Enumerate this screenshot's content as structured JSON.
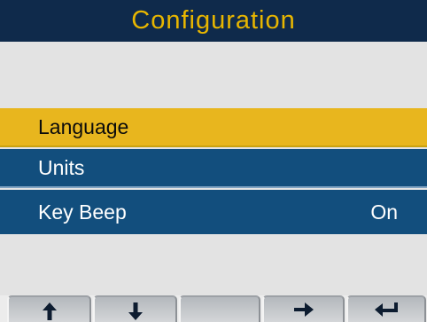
{
  "header": {
    "title": "Configuration"
  },
  "menu": {
    "items": [
      {
        "label": "Language",
        "value": ""
      },
      {
        "label": "Units",
        "value": ""
      },
      {
        "label": "Key Beep",
        "value": "On"
      }
    ]
  },
  "softkeys": [
    {
      "icon": "arrow-up-icon"
    },
    {
      "icon": "arrow-down-icon"
    },
    {
      "icon": ""
    },
    {
      "icon": "arrow-right-icon"
    },
    {
      "icon": "back-arrow-icon"
    }
  ],
  "colors": {
    "title_bg": "#0f2a4b",
    "title_text": "#e8b600",
    "row_bg": "#124e7d",
    "selected_bg": "#e8b61e",
    "screen_bg": "#e3e3e3"
  }
}
